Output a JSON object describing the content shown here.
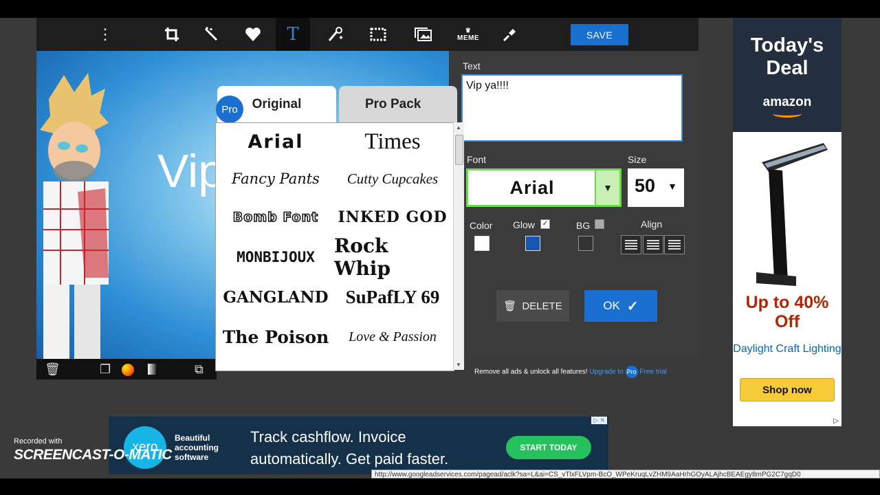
{
  "toolbar": {
    "icons": [
      "more-icon",
      "crop-icon",
      "magic-wand-icon",
      "heart-icon",
      "text-icon",
      "effects-icon",
      "frame-icon",
      "overlay-icon",
      "meme-icon",
      "touchup-icon"
    ],
    "text_tool_label": "T",
    "meme_label": "MEME",
    "save_label": "SAVE",
    "active_color": "#3d7fe0"
  },
  "canvas": {
    "text": "Vip"
  },
  "font_panel": {
    "tabs": [
      "Original",
      "Pro Pack"
    ],
    "pro_badge": "Pro",
    "fonts": [
      "Arial",
      "Times",
      "Fancy Pants",
      "Cutty Cupcakes",
      "Bomb Font",
      "INKED GOD",
      "MONBIJOUX",
      "Rock Whip",
      "GANGLAND",
      "SuPafLY 69",
      "The Poison",
      "Love & Passion"
    ]
  },
  "editor": {
    "text_label": "Text",
    "text_value": "Vip ya!!!!",
    "font_label": "Font",
    "font_value": "Arial",
    "size_label": "Size",
    "size_value": "50",
    "color_label": "Color",
    "glow_label": "Glow",
    "glow_checked": "✓",
    "bg_label": "BG",
    "align_label": "Align",
    "delete_label": "DELETE",
    "ok_label": "OK",
    "ok_check": "✓",
    "upgrade_text": "Remove all ads & unlock all features!",
    "upgrade_link": "Upgrade to",
    "upgrade_badge": "Pro",
    "free_trial": "Free trial",
    "color_swatch": "#ffffff",
    "glow_swatch": "#1a56b0",
    "accent": "#1a6fd1"
  },
  "amazon_ad": {
    "title": "Today's Deal",
    "brand": "amazon",
    "deal": "Up to 40% Off",
    "product": "Daylight Craft Lighting",
    "cta": "Shop now",
    "adchoice": "▷"
  },
  "xero_ad": {
    "logo": "xero",
    "tagline": [
      "Beautiful",
      "accounting",
      "software"
    ],
    "headline": [
      "Track cashflow. Invoice",
      "automatically. Get paid faster."
    ],
    "cta": "START TODAY",
    "adchoice": "▷ ✕"
  },
  "status_url": "http://www.googleadservices.com/pagead/aclk?sa=L&ai=CS_vTlxFLVpm-BcO_WPeKruqLvZHM9AaHrhGOyALAjhcBEAEgy8mPG2C7gqD0",
  "watermark": {
    "recorded_with": "Recorded with",
    "logo": "SCREENCAST-O-MATIC"
  }
}
